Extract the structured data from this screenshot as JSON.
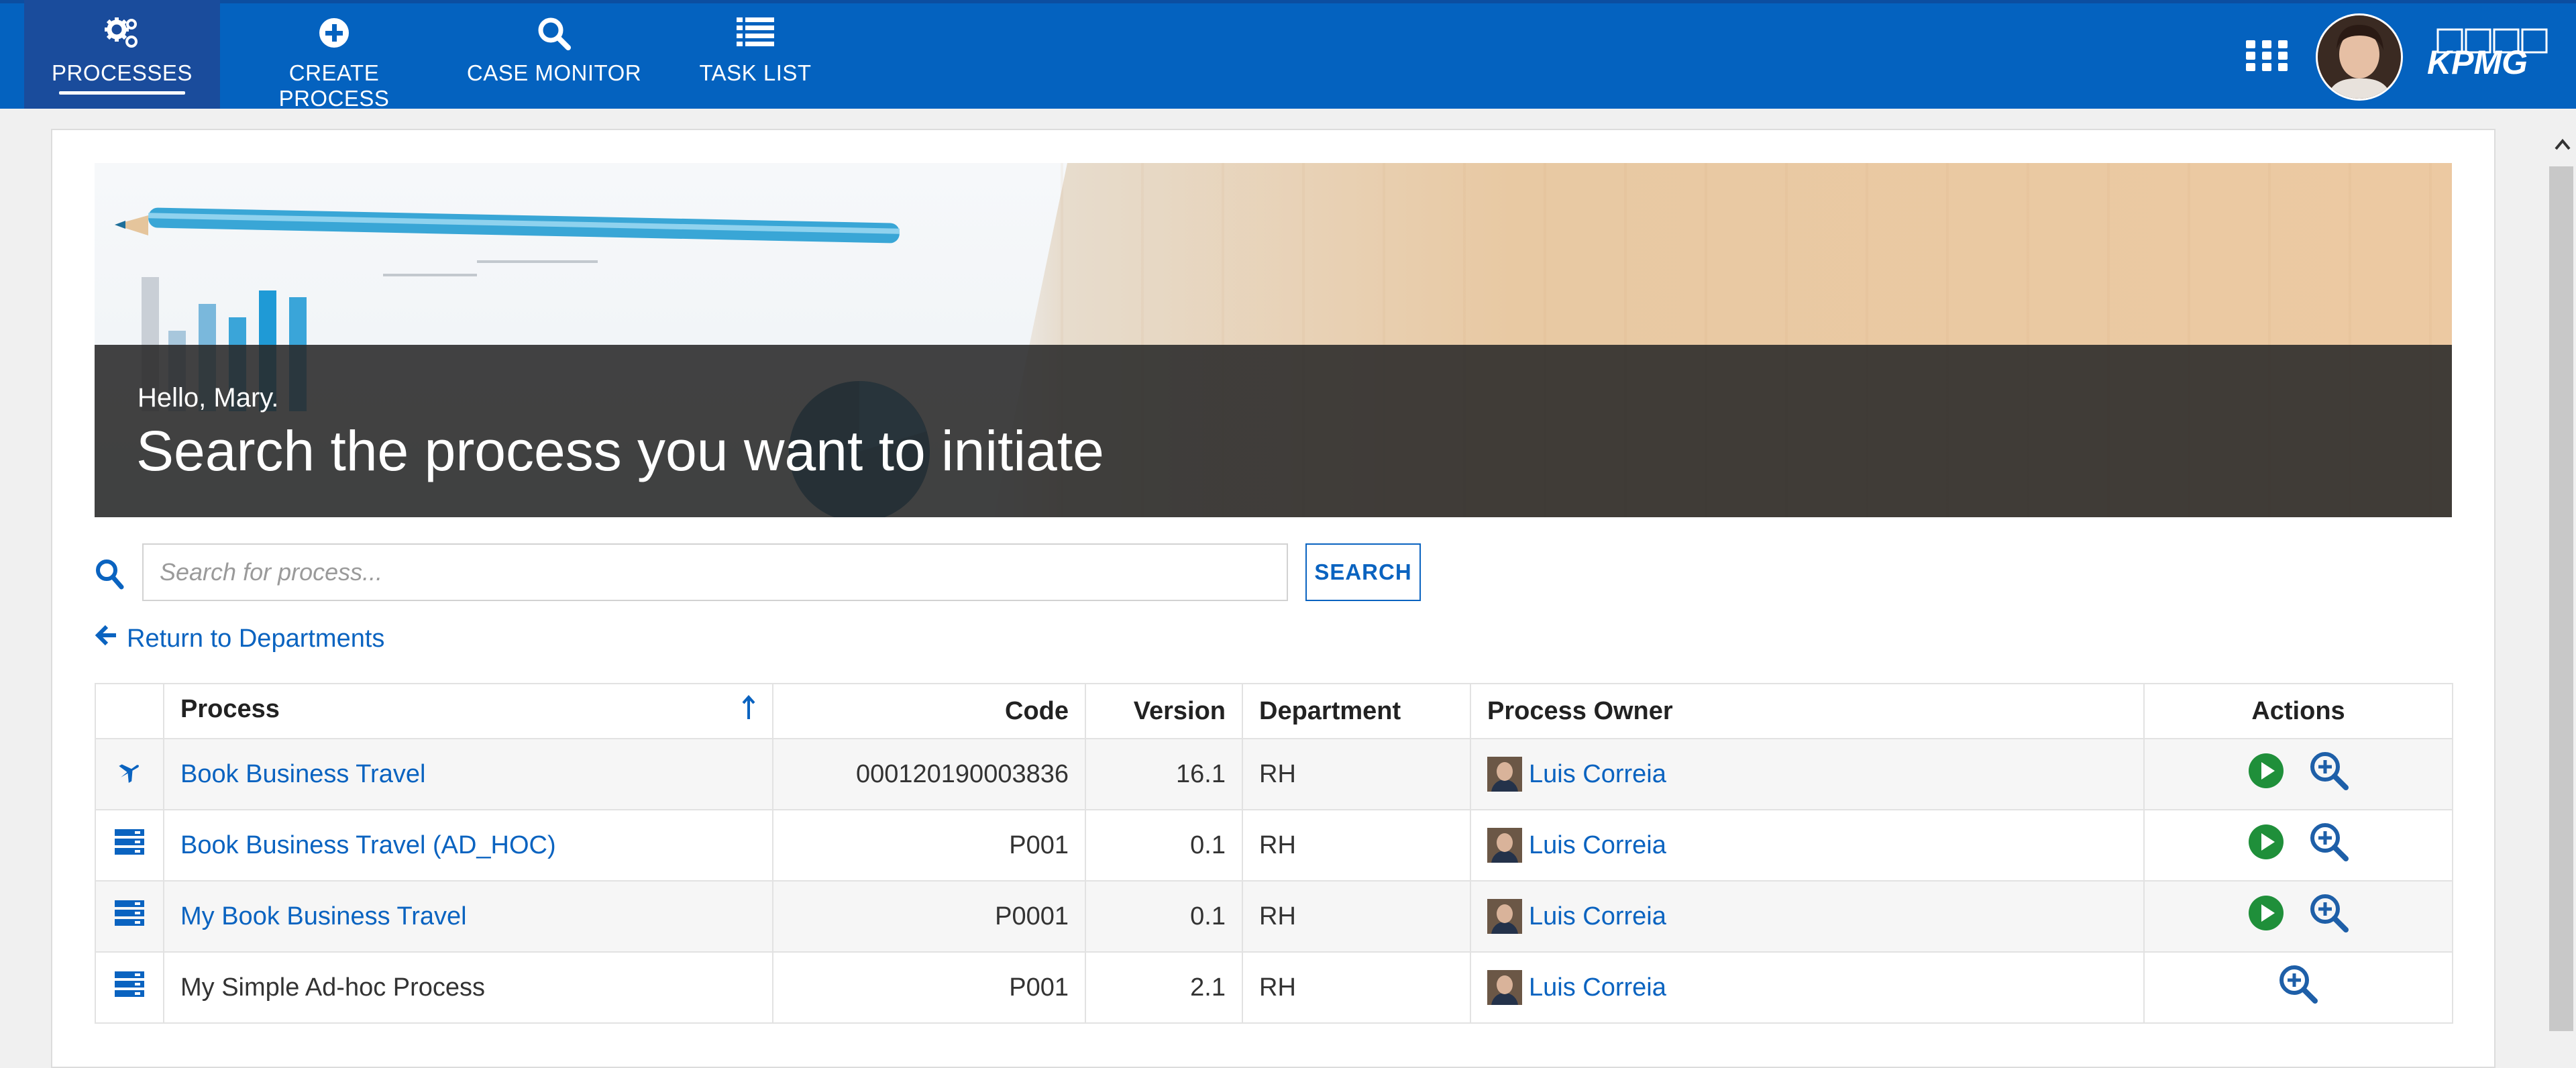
{
  "colors": {
    "nav_bg": "#0462bf",
    "nav_active": "#1a4c9c",
    "link": "#0a63c0",
    "play": "#1f8f3a",
    "zoom": "#1e5fa8"
  },
  "nav": {
    "items": [
      {
        "label": "PROCESSES",
        "icon": "gears-icon",
        "active": true
      },
      {
        "label": "CREATE PROCESS",
        "icon": "plus-circle-icon",
        "active": false
      },
      {
        "label": "CASE MONITOR",
        "icon": "search-icon",
        "active": false
      },
      {
        "label": "TASK LIST",
        "icon": "list-icon",
        "active": false
      }
    ],
    "apps_icon": "apps-grid-icon",
    "logo_text": "KPMG"
  },
  "banner": {
    "greeting": "Hello, Mary.",
    "headline": "Search the process you want to initiate"
  },
  "search": {
    "placeholder": "Search for process...",
    "value": "",
    "button_label": "SEARCH"
  },
  "return_link": "Return to Departments",
  "table": {
    "columns": {
      "process": "Process",
      "code": "Code",
      "version": "Version",
      "department": "Department",
      "owner": "Process Owner",
      "actions": "Actions"
    },
    "sort": {
      "column": "Process",
      "direction": "ascending"
    },
    "rows": [
      {
        "icon": "airplane-icon",
        "process": "Book Business Travel",
        "code": "000120190003836",
        "version": "16.1",
        "department": "RH",
        "owner": "Luis Correia",
        "link": true,
        "actions": [
          "play",
          "zoom"
        ]
      },
      {
        "icon": "stack-icon",
        "process": "Book Business Travel (AD_HOC)",
        "code": "P001",
        "version": "0.1",
        "department": "RH",
        "owner": "Luis Correia",
        "link": true,
        "actions": [
          "play",
          "zoom"
        ]
      },
      {
        "icon": "stack-icon",
        "process": "My Book Business Travel",
        "code": "P0001",
        "version": "0.1",
        "department": "RH",
        "owner": "Luis Correia",
        "link": true,
        "actions": [
          "play",
          "zoom"
        ]
      },
      {
        "icon": "stack-icon",
        "process": "My Simple Ad-hoc Process",
        "code": "P001",
        "version": "2.1",
        "department": "RH",
        "owner": "Luis Correia",
        "link": false,
        "actions": [
          "zoom"
        ]
      }
    ]
  }
}
